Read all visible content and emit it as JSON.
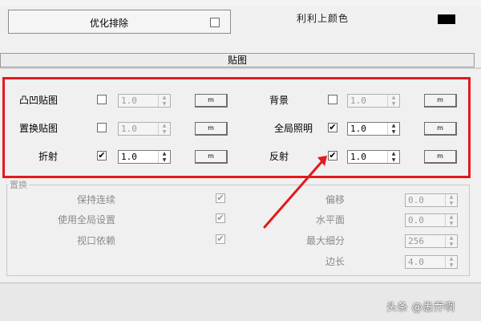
{
  "upper": {
    "optimize_label": "优化排除",
    "right_partial": "利利上颜色",
    "swatch_color": "#000000"
  },
  "rollout": {
    "title": "贴图"
  },
  "maps": {
    "rows": [
      {
        "left_label": "凸凹贴图",
        "left_checked": false,
        "left_value": "1.0",
        "left_enabled": false,
        "left_btn": "m",
        "right_label": "背景",
        "right_checked": false,
        "right_value": "1.0",
        "right_enabled": false,
        "right_btn": "m"
      },
      {
        "left_label": "置换贴图",
        "left_checked": false,
        "left_value": "1.0",
        "left_enabled": false,
        "left_btn": "m",
        "right_label": "全局照明",
        "right_checked": true,
        "right_value": "1.0",
        "right_enabled": true,
        "right_btn": "m"
      },
      {
        "left_label": "折射",
        "left_checked": true,
        "left_value": "1.0",
        "left_enabled": true,
        "left_btn": "m",
        "right_label": "反射",
        "right_checked": true,
        "right_value": "1.0",
        "right_enabled": true,
        "right_btn": "m"
      }
    ]
  },
  "displacement": {
    "title": "置换",
    "checks": [
      {
        "label": "保持连续",
        "checked": true
      },
      {
        "label": "使用全局设置",
        "checked": true
      },
      {
        "label": "视口依赖",
        "checked": true
      }
    ],
    "fields": [
      {
        "label": "偏移",
        "value": "0.0"
      },
      {
        "label": "水平面",
        "value": "0.0"
      },
      {
        "label": "最大细分",
        "value": "256"
      },
      {
        "label": "边长",
        "value": "4.0"
      }
    ]
  },
  "watermark": "头条 @愚乔啊",
  "highlight_color": "#e3191c"
}
